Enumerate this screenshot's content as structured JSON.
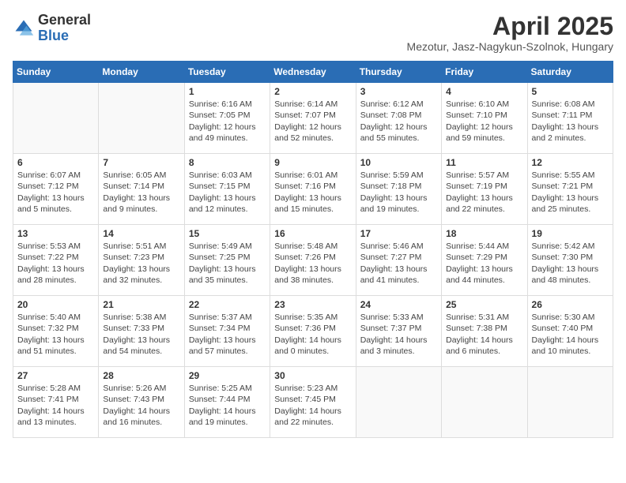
{
  "header": {
    "logo_general": "General",
    "logo_blue": "Blue",
    "title": "April 2025",
    "subtitle": "Mezotur, Jasz-Nagykun-Szolnok, Hungary"
  },
  "days_of_week": [
    "Sunday",
    "Monday",
    "Tuesday",
    "Wednesday",
    "Thursday",
    "Friday",
    "Saturday"
  ],
  "weeks": [
    [
      {
        "day": "",
        "detail": ""
      },
      {
        "day": "",
        "detail": ""
      },
      {
        "day": "1",
        "detail": "Sunrise: 6:16 AM\nSunset: 7:05 PM\nDaylight: 12 hours and 49 minutes."
      },
      {
        "day": "2",
        "detail": "Sunrise: 6:14 AM\nSunset: 7:07 PM\nDaylight: 12 hours and 52 minutes."
      },
      {
        "day": "3",
        "detail": "Sunrise: 6:12 AM\nSunset: 7:08 PM\nDaylight: 12 hours and 55 minutes."
      },
      {
        "day": "4",
        "detail": "Sunrise: 6:10 AM\nSunset: 7:10 PM\nDaylight: 12 hours and 59 minutes."
      },
      {
        "day": "5",
        "detail": "Sunrise: 6:08 AM\nSunset: 7:11 PM\nDaylight: 13 hours and 2 minutes."
      }
    ],
    [
      {
        "day": "6",
        "detail": "Sunrise: 6:07 AM\nSunset: 7:12 PM\nDaylight: 13 hours and 5 minutes."
      },
      {
        "day": "7",
        "detail": "Sunrise: 6:05 AM\nSunset: 7:14 PM\nDaylight: 13 hours and 9 minutes."
      },
      {
        "day": "8",
        "detail": "Sunrise: 6:03 AM\nSunset: 7:15 PM\nDaylight: 13 hours and 12 minutes."
      },
      {
        "day": "9",
        "detail": "Sunrise: 6:01 AM\nSunset: 7:16 PM\nDaylight: 13 hours and 15 minutes."
      },
      {
        "day": "10",
        "detail": "Sunrise: 5:59 AM\nSunset: 7:18 PM\nDaylight: 13 hours and 19 minutes."
      },
      {
        "day": "11",
        "detail": "Sunrise: 5:57 AM\nSunset: 7:19 PM\nDaylight: 13 hours and 22 minutes."
      },
      {
        "day": "12",
        "detail": "Sunrise: 5:55 AM\nSunset: 7:21 PM\nDaylight: 13 hours and 25 minutes."
      }
    ],
    [
      {
        "day": "13",
        "detail": "Sunrise: 5:53 AM\nSunset: 7:22 PM\nDaylight: 13 hours and 28 minutes."
      },
      {
        "day": "14",
        "detail": "Sunrise: 5:51 AM\nSunset: 7:23 PM\nDaylight: 13 hours and 32 minutes."
      },
      {
        "day": "15",
        "detail": "Sunrise: 5:49 AM\nSunset: 7:25 PM\nDaylight: 13 hours and 35 minutes."
      },
      {
        "day": "16",
        "detail": "Sunrise: 5:48 AM\nSunset: 7:26 PM\nDaylight: 13 hours and 38 minutes."
      },
      {
        "day": "17",
        "detail": "Sunrise: 5:46 AM\nSunset: 7:27 PM\nDaylight: 13 hours and 41 minutes."
      },
      {
        "day": "18",
        "detail": "Sunrise: 5:44 AM\nSunset: 7:29 PM\nDaylight: 13 hours and 44 minutes."
      },
      {
        "day": "19",
        "detail": "Sunrise: 5:42 AM\nSunset: 7:30 PM\nDaylight: 13 hours and 48 minutes."
      }
    ],
    [
      {
        "day": "20",
        "detail": "Sunrise: 5:40 AM\nSunset: 7:32 PM\nDaylight: 13 hours and 51 minutes."
      },
      {
        "day": "21",
        "detail": "Sunrise: 5:38 AM\nSunset: 7:33 PM\nDaylight: 13 hours and 54 minutes."
      },
      {
        "day": "22",
        "detail": "Sunrise: 5:37 AM\nSunset: 7:34 PM\nDaylight: 13 hours and 57 minutes."
      },
      {
        "day": "23",
        "detail": "Sunrise: 5:35 AM\nSunset: 7:36 PM\nDaylight: 14 hours and 0 minutes."
      },
      {
        "day": "24",
        "detail": "Sunrise: 5:33 AM\nSunset: 7:37 PM\nDaylight: 14 hours and 3 minutes."
      },
      {
        "day": "25",
        "detail": "Sunrise: 5:31 AM\nSunset: 7:38 PM\nDaylight: 14 hours and 6 minutes."
      },
      {
        "day": "26",
        "detail": "Sunrise: 5:30 AM\nSunset: 7:40 PM\nDaylight: 14 hours and 10 minutes."
      }
    ],
    [
      {
        "day": "27",
        "detail": "Sunrise: 5:28 AM\nSunset: 7:41 PM\nDaylight: 14 hours and 13 minutes."
      },
      {
        "day": "28",
        "detail": "Sunrise: 5:26 AM\nSunset: 7:43 PM\nDaylight: 14 hours and 16 minutes."
      },
      {
        "day": "29",
        "detail": "Sunrise: 5:25 AM\nSunset: 7:44 PM\nDaylight: 14 hours and 19 minutes."
      },
      {
        "day": "30",
        "detail": "Sunrise: 5:23 AM\nSunset: 7:45 PM\nDaylight: 14 hours and 22 minutes."
      },
      {
        "day": "",
        "detail": ""
      },
      {
        "day": "",
        "detail": ""
      },
      {
        "day": "",
        "detail": ""
      }
    ]
  ]
}
